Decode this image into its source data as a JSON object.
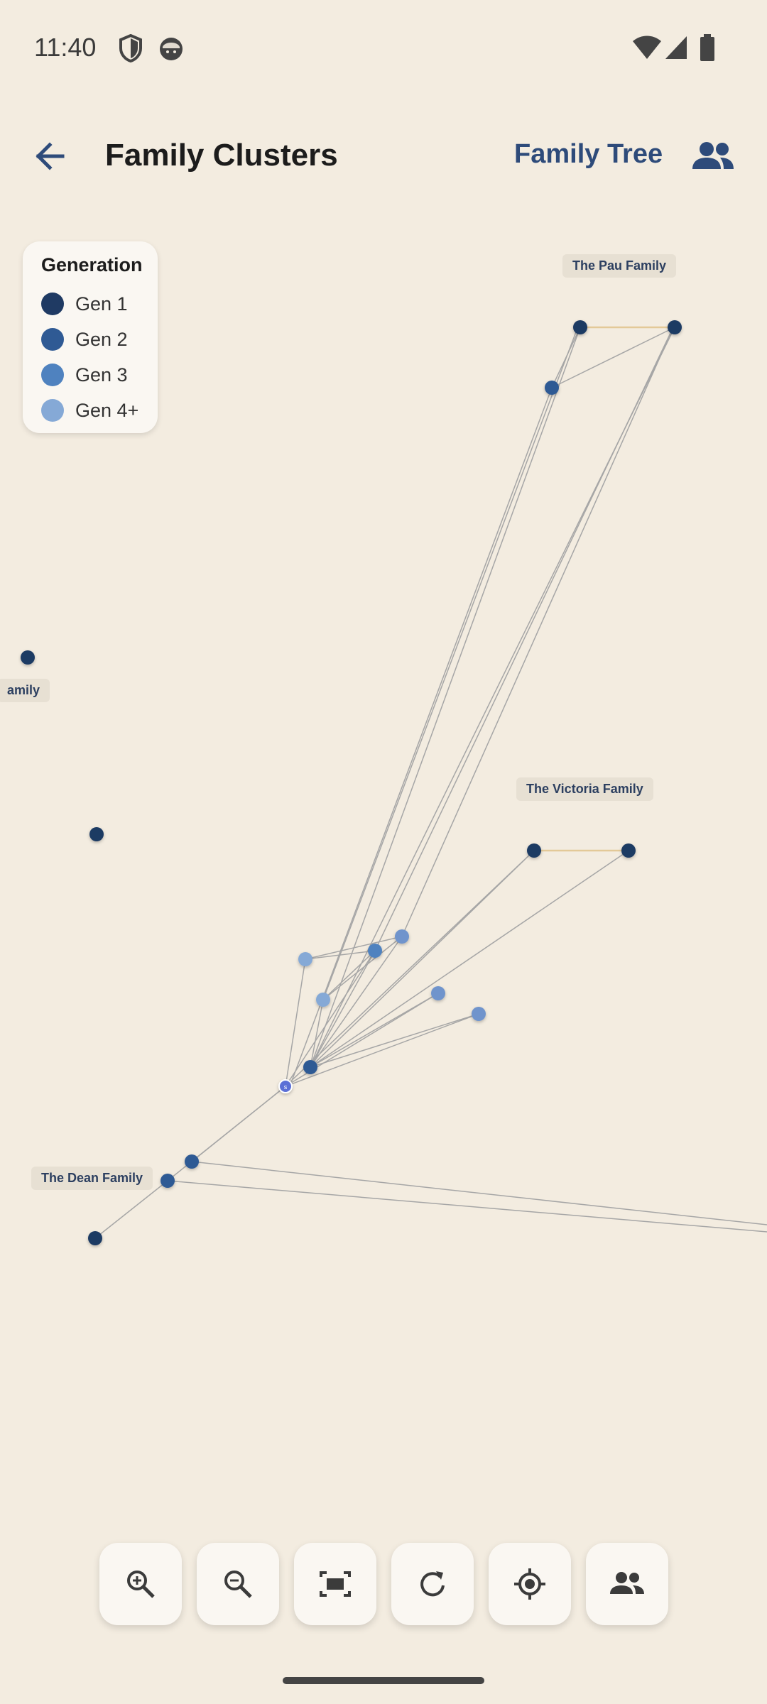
{
  "status_bar": {
    "time": "11:40",
    "icons": [
      "shield-icon",
      "face-icon",
      "wifi-icon",
      "signal-icon",
      "battery-icon"
    ]
  },
  "app_bar": {
    "back_icon": "arrow-back-icon",
    "title": "Family Clusters",
    "link_label": "Family Tree",
    "people_icon": "people-icon"
  },
  "legend": {
    "title": "Generation",
    "items": [
      {
        "label": "Gen 1",
        "color": "#1f3a63"
      },
      {
        "label": "Gen 2",
        "color": "#2f5a94"
      },
      {
        "label": "Gen 3",
        "color": "#4f82bf"
      },
      {
        "label": "Gen 4+",
        "color": "#85a9d6"
      }
    ]
  },
  "families": {
    "pau": "The Pau Family",
    "left": "amily",
    "victoria": "The Victoria Family",
    "dean": "The Dean Family"
  },
  "graph_node_badge": "s",
  "controls": [
    {
      "icon": "zoom-in-icon"
    },
    {
      "icon": "zoom-out-icon"
    },
    {
      "icon": "fit-screen-icon"
    },
    {
      "icon": "reset-icon"
    },
    {
      "icon": "locate-icon"
    },
    {
      "icon": "people-icon"
    }
  ],
  "colors": {
    "background": "#f3ece0",
    "accent": "#2e4b7a",
    "spouse_edge": "#e3c998",
    "edge": "#a6a6a6",
    "self_node": "#5b6fd6"
  }
}
